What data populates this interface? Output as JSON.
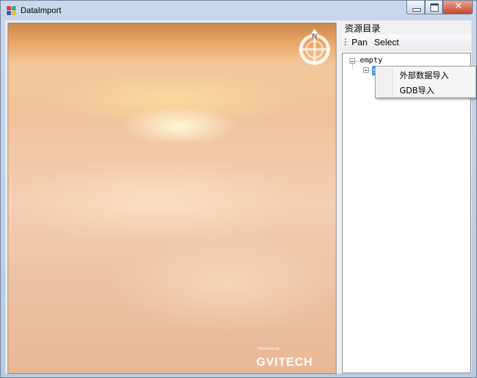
{
  "window": {
    "title": "DataImport"
  },
  "panel": {
    "title": "资源目录"
  },
  "toolbar": {
    "pan_label": "Pan",
    "select_label": "Select"
  },
  "tree": {
    "root_label": "empty",
    "child_label": "s"
  },
  "context_menu": {
    "items": [
      {
        "label": "外部数据导入"
      },
      {
        "label": "GDB导入"
      }
    ]
  },
  "map": {
    "compass_label": "N",
    "logo_powered": "Powered By",
    "logo_text": "GVITECH"
  },
  "colors": {
    "accent": "#3399ff",
    "title_bar": "#c9d7ea",
    "close_button": "#c7442b"
  }
}
